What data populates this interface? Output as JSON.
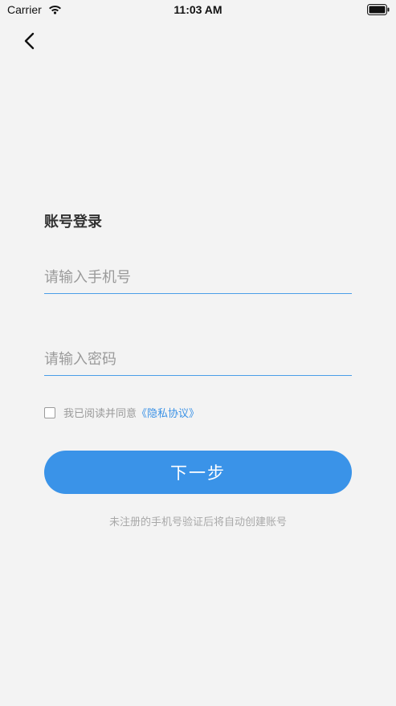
{
  "status_bar": {
    "carrier": "Carrier",
    "time": "11:03 AM",
    "icons": [
      "wifi-icon",
      "battery-icon"
    ]
  },
  "nav": {
    "back_icon": "chevron-left-icon"
  },
  "login": {
    "title": "账号登录",
    "phone_placeholder": "请输入手机号",
    "password_placeholder": "请输入密码",
    "agreement_text": "我已阅读并同意",
    "privacy_link": "《隐私协议》",
    "agreement_checked": false,
    "next_label": "下一步",
    "footer_note": "未注册的手机号验证后将自动创建账号"
  },
  "colors": {
    "background": "#f3f3f3",
    "accent": "#3a93e8",
    "input_underline": "#4a9ee8",
    "placeholder": "#9a9a9a"
  }
}
